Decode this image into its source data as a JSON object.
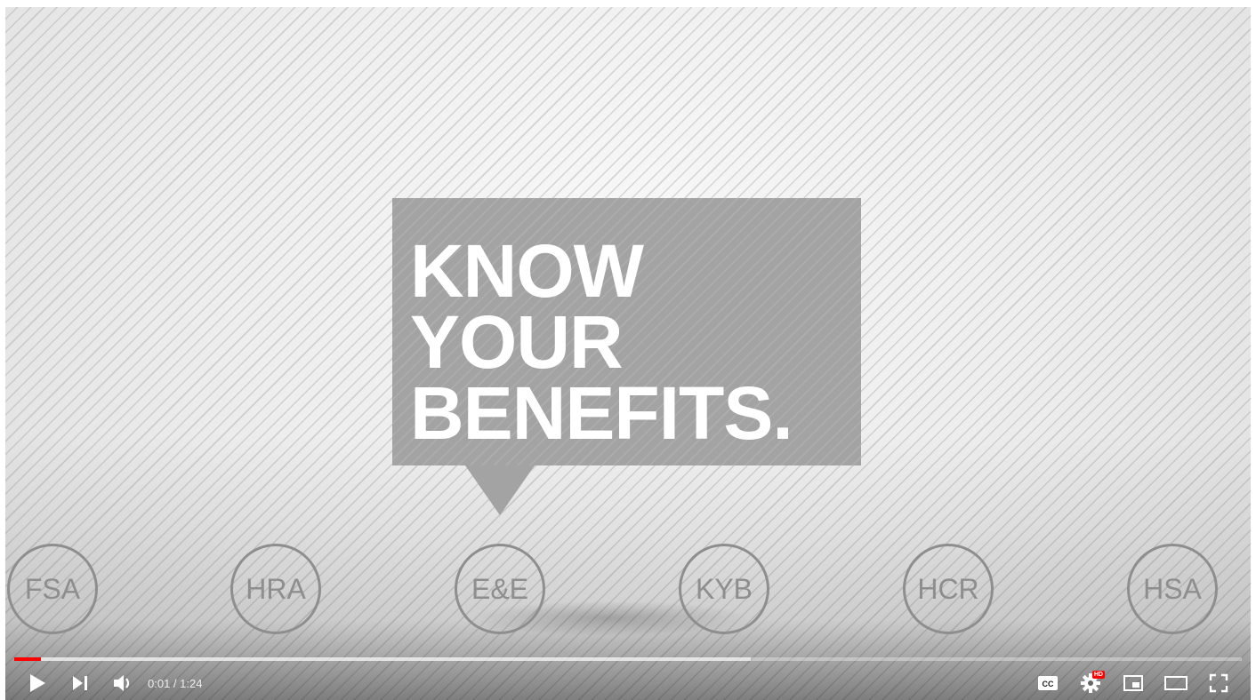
{
  "video": {
    "headline_lines": [
      "KNOW",
      "YOUR",
      "BENEFITS."
    ],
    "circles": [
      "FSA",
      "HRA",
      "E&E",
      "KYB",
      "HCR",
      "HSA"
    ]
  },
  "player": {
    "progress": {
      "played_fraction": 0.022,
      "buffered_fraction": 0.6
    },
    "time_display": "0:01 / 1:24",
    "icons": {
      "play": "play-icon",
      "next": "next-icon",
      "volume": "volume-icon",
      "captions": "captions-icon",
      "settings": "settings-icon",
      "miniplayer": "miniplayer-icon",
      "theater": "theater-mode-icon",
      "fullscreen": "fullscreen-icon"
    },
    "settings_badge": "HD",
    "captions_label": "CC",
    "accent_color": "#ff0000"
  }
}
